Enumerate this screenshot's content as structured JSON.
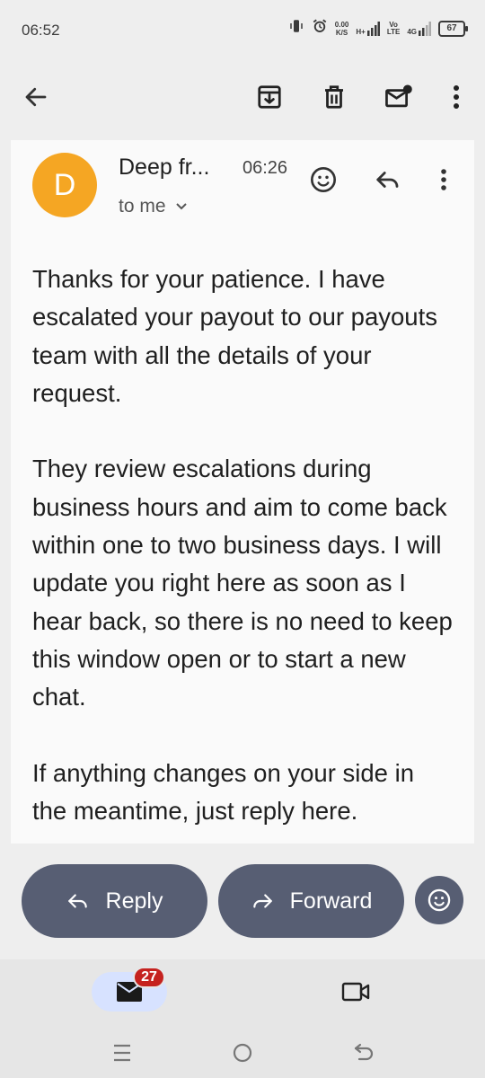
{
  "status_bar": {
    "time": "06:52",
    "net_speed_value": "0.00",
    "net_speed_unit": "K/S",
    "signal1_tag": "H+",
    "volte_tag_top": "Vo",
    "volte_tag_bottom": "LTE",
    "signal2_tag": "4G",
    "battery_level": "67"
  },
  "toolbar": {
    "icons": [
      "back-arrow-icon",
      "archive-icon",
      "delete-icon",
      "mark-unread-icon",
      "more-vert-icon"
    ]
  },
  "email": {
    "avatar_letter": "D",
    "avatar_color": "#f5a623",
    "sender": "Deep fr...",
    "time": "06:26",
    "recipient": "to me",
    "paragraphs": [
      "Thanks for your patience. I have escalated your payout to our payouts team with all the details of your request.",
      "They review escalations during business hours and aim to come back within one to two business days. I will update you right here as soon as I hear back, so there is no need to keep this window open or to start a new chat.",
      "If anything changes on your side in the meantime, just reply here."
    ]
  },
  "actions": {
    "reply_label": "Reply",
    "forward_label": "Forward",
    "button_color": "#575e73"
  },
  "bottom_nav": {
    "mail_badge": "27",
    "badge_color": "#c5221f",
    "active_tab_color": "#d7e2ff"
  }
}
